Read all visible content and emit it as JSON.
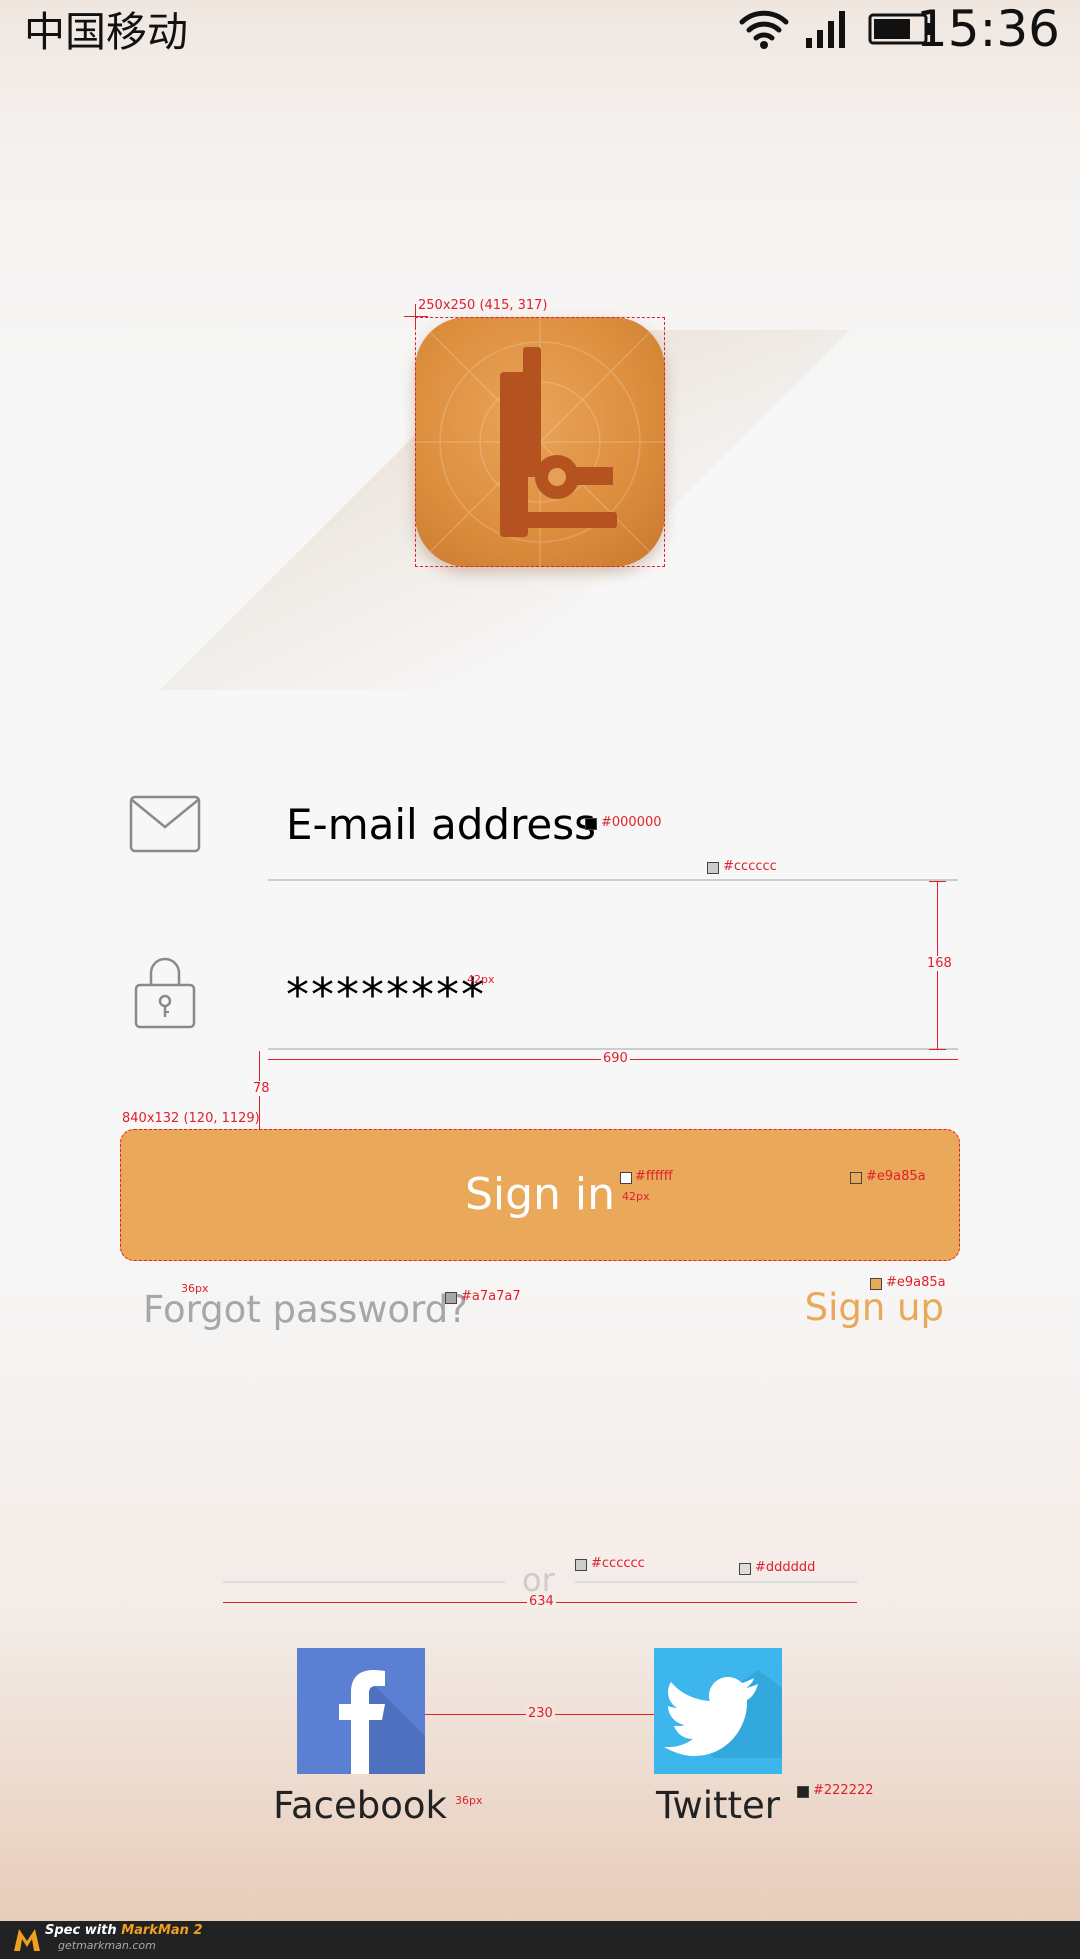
{
  "status_bar": {
    "carrier": "中国移动",
    "time": "15:36",
    "icons": [
      "wifi-icon",
      "signal-icon",
      "battery-icon"
    ]
  },
  "logo": {
    "icon": "app-logo-icon",
    "spec_label": "250x250 (415, 317)"
  },
  "form": {
    "email": {
      "icon": "envelope-icon",
      "placeholder": "E-mail address",
      "spec_color": "#000000",
      "spec_line_color": "#cccccc"
    },
    "password": {
      "icon": "lock-icon",
      "value": "********",
      "spec_font": "42px"
    },
    "spec_height": "168",
    "spec_width": "690",
    "spec_gap": "78"
  },
  "sign_in": {
    "label": "Sign in",
    "color": "#e9a85a",
    "spec_label": "840x132 (120, 1129)",
    "spec_text_color": "#ffffff",
    "spec_font": "42px",
    "spec_bg": "#e9a85a"
  },
  "links": {
    "forgot_password": "Forgot password?",
    "forgot_spec_font": "36px",
    "forgot_spec_color": "#a7a7a7",
    "sign_up": "Sign up",
    "sign_up_spec_color": "#e9a85a"
  },
  "divider": {
    "label": "or",
    "spec_text_color": "#cccccc",
    "spec_line_color": "#dddddd",
    "spec_width": "634"
  },
  "social": {
    "facebook_label": "Facebook",
    "twitter_label": "Twitter",
    "facebook_color": "#5b7fd3",
    "twitter_color": "#3cb6ec",
    "spec_gap": "230",
    "spec_font": "36px",
    "spec_text_color": "#222222"
  },
  "footer": {
    "brand_prefix": "Spec with ",
    "brand_name": "MarkMan 2",
    "site": "getmarkman.com"
  }
}
